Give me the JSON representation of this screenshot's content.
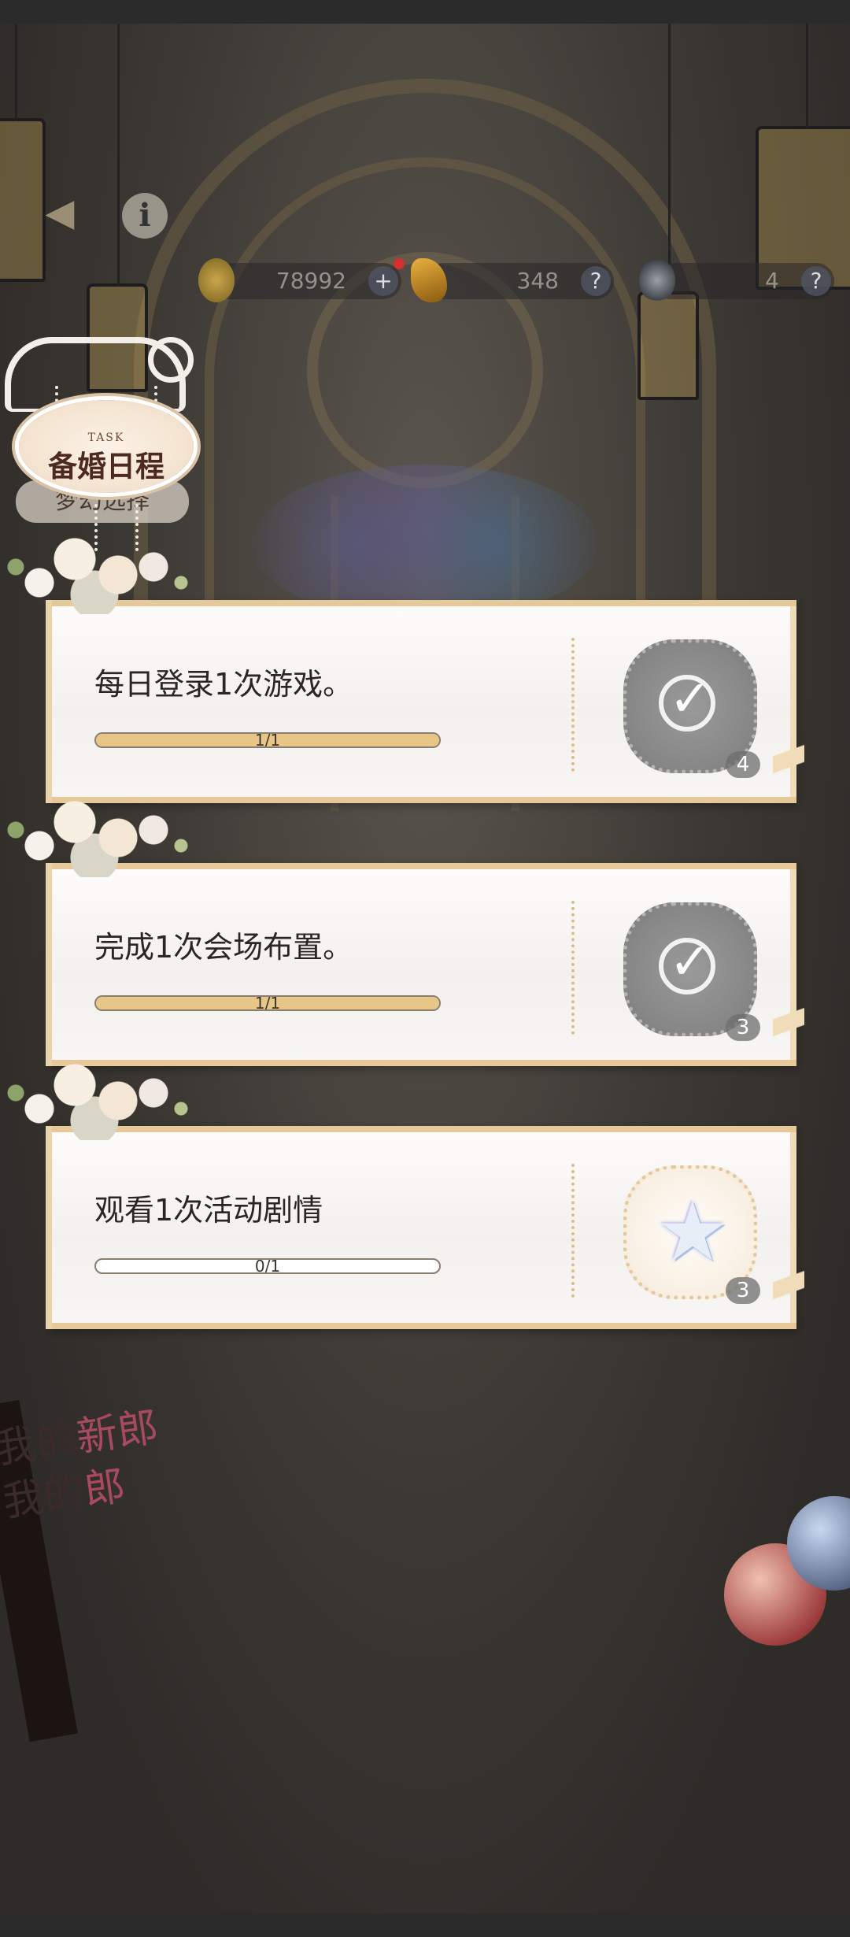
{
  "hud": {
    "back_icon": "back-arrow-icon",
    "info_icon": "info-icon",
    "info_label": "i",
    "currencies": [
      {
        "name": "gold-coin",
        "value": "78992",
        "button": "+"
      },
      {
        "name": "crystal",
        "value": "348",
        "button": "?"
      },
      {
        "name": "flower-token",
        "value": "4",
        "button": "?"
      }
    ]
  },
  "title": {
    "small": "TASK",
    "main": "备婚日程",
    "sub_label": "梦幻选择"
  },
  "background": {
    "sign_line1_a": "我的",
    "sign_line1_b": "新郎",
    "sign_line2_a": "我的",
    "sign_line2_b": "郎"
  },
  "tasks": [
    {
      "text": "每日登录1次游戏。",
      "progress_label": "1/1",
      "progress": 1.0,
      "status": "completed",
      "reward_icon": "check-circle-icon",
      "reward_count": "4"
    },
    {
      "text": "完成1次会场布置。",
      "progress_label": "1/1",
      "progress": 1.0,
      "status": "completed",
      "reward_icon": "check-circle-icon",
      "reward_count": "3"
    },
    {
      "text": "观看1次活动剧情",
      "progress_label": "0/1",
      "progress": 0.0,
      "status": "incomplete",
      "reward_icon": "star-crystal-icon",
      "reward_count": "3"
    }
  ],
  "colors": {
    "card_border": "#e6c99a",
    "progress_fill": "#e8c688",
    "title_text": "#4c2a22"
  }
}
